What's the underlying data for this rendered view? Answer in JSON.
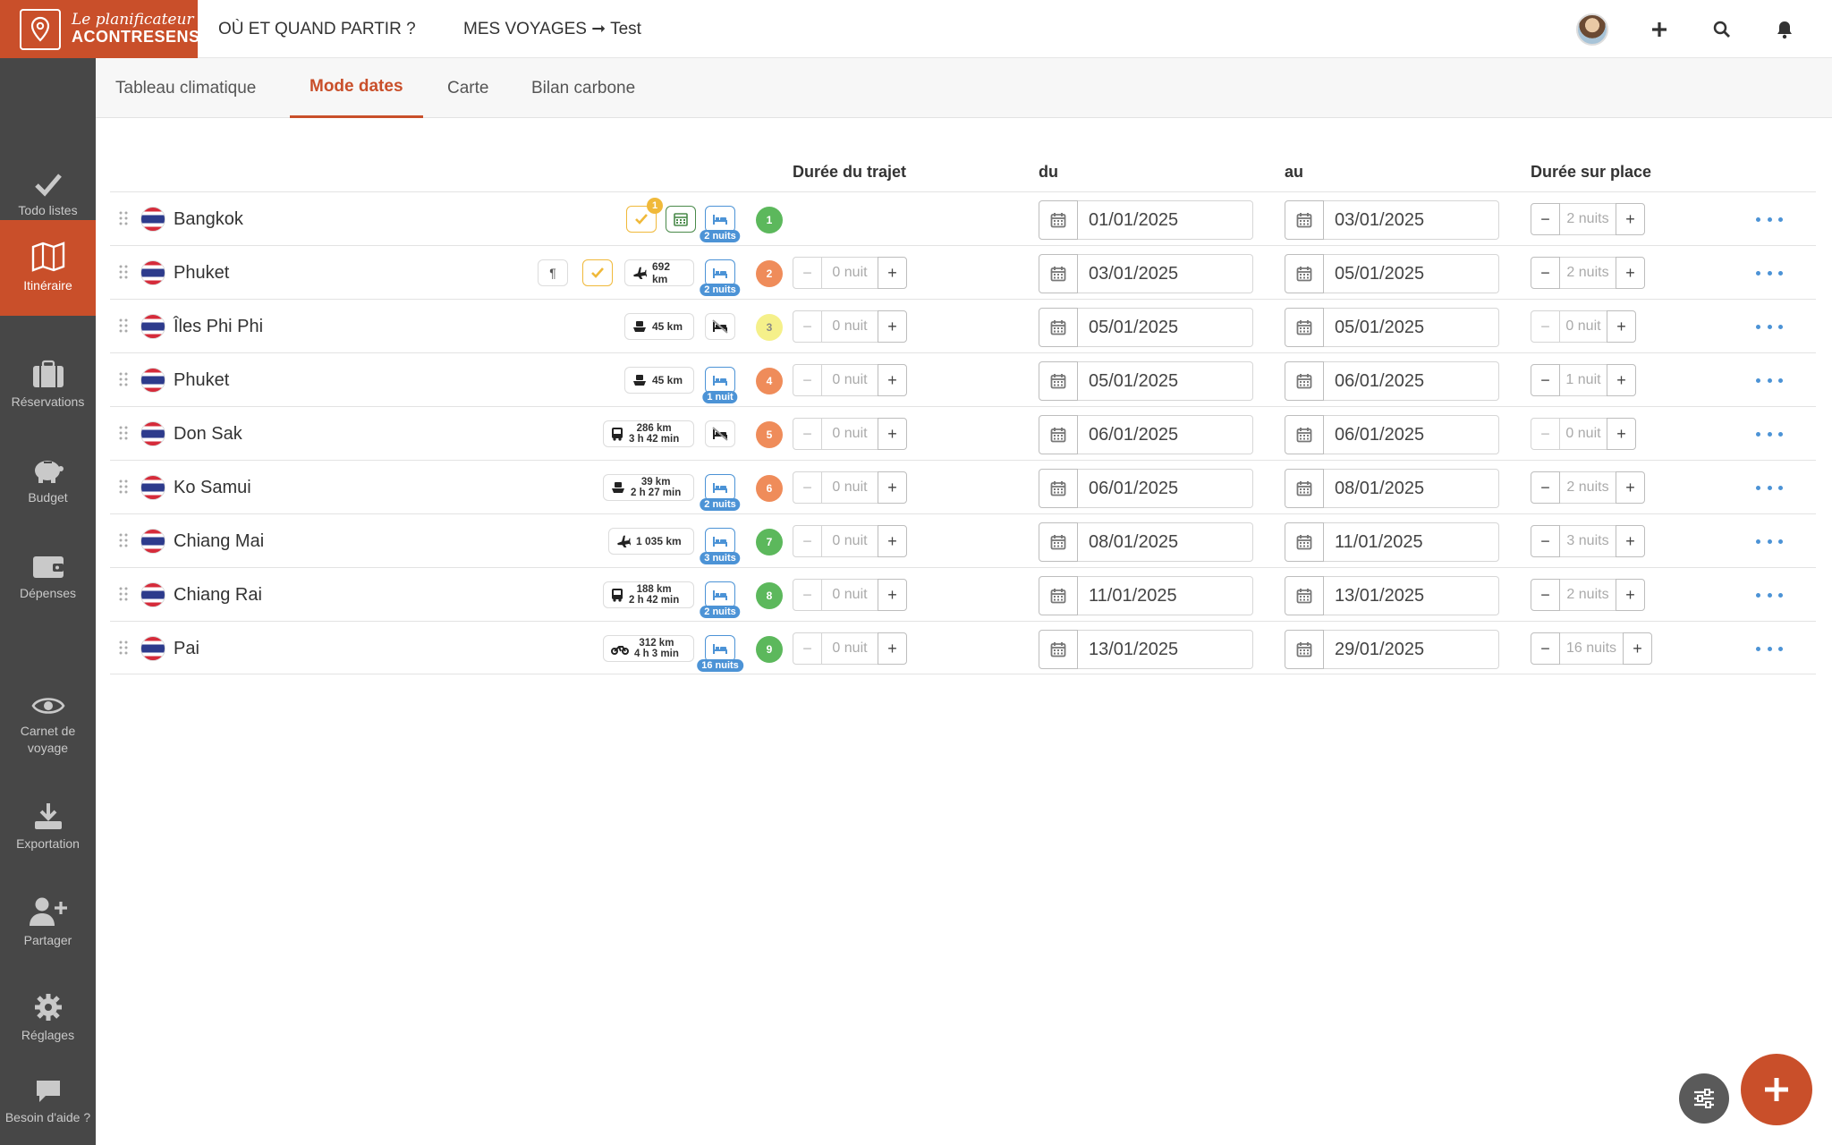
{
  "app": {
    "logo_line1": "Le planificateur",
    "logo_line2": "ACONTRESENS"
  },
  "topnav": {
    "where_when": "OÙ ET QUAND PARTIR ?",
    "my_trips": "MES VOYAGES ➞ Test"
  },
  "sidebar": {
    "items": [
      {
        "label": "Todo listes",
        "icon": "check-icon"
      },
      {
        "label": "Itinéraire",
        "icon": "map-icon",
        "active": true
      },
      {
        "label": "Réservations",
        "icon": "suitcase-icon"
      },
      {
        "label": "Budget",
        "icon": "piggy-bank-icon"
      },
      {
        "label": "Dépenses",
        "icon": "wallet-icon"
      },
      {
        "label": "Carnet de voyage",
        "icon": "eye-icon"
      },
      {
        "label": "Exportation",
        "icon": "download-icon"
      },
      {
        "label": "Partager",
        "icon": "user-plus-icon"
      },
      {
        "label": "Réglages",
        "icon": "gear-icon"
      },
      {
        "label": "Besoin d'aide ?",
        "icon": "chat-icon"
      }
    ]
  },
  "tabs": [
    {
      "label": "Tableau climatique"
    },
    {
      "label": "Mode dates",
      "active": true
    },
    {
      "label": "Carte"
    },
    {
      "label": "Bilan carbone"
    }
  ],
  "columns": {
    "travel": "Durée du trajet",
    "from": "du",
    "to": "au",
    "stay": "Durée sur place"
  },
  "colors": {
    "accent": "#c94f2a",
    "blue": "#4c93d6",
    "sidebar": "#474747"
  },
  "rows": [
    {
      "city": "Bangkok",
      "transport": null,
      "step": "1",
      "step_color": "#5cb85c",
      "travel": null,
      "from": "01/01/2025",
      "to": "03/01/2025",
      "stay": "2 nuits",
      "nights_tag": "2 nuits",
      "bed": true,
      "todo_count": "1"
    },
    {
      "city": "Phuket",
      "transport": {
        "mode": "plane",
        "line1": "692 km",
        "line2": ""
      },
      "step": "2",
      "step_color": "#ef8c5a",
      "travel": "0 nuit",
      "from": "03/01/2025",
      "to": "05/01/2025",
      "stay": "2 nuits",
      "nights_tag": "2 nuits",
      "bed": true
    },
    {
      "city": "Îles Phi Phi",
      "transport": {
        "mode": "boat",
        "line1": "45 km",
        "line2": ""
      },
      "step": "3",
      "step_color": "#f5f08a",
      "travel": "0 nuit",
      "from": "05/01/2025",
      "to": "05/01/2025",
      "stay": "0 nuit",
      "nights_tag": "",
      "bed": false
    },
    {
      "city": "Phuket",
      "transport": {
        "mode": "boat",
        "line1": "45 km",
        "line2": ""
      },
      "step": "4",
      "step_color": "#ef8c5a",
      "travel": "0 nuit",
      "from": "05/01/2025",
      "to": "06/01/2025",
      "stay": "1 nuit",
      "nights_tag": "1 nuit",
      "bed": true
    },
    {
      "city": "Don Sak",
      "transport": {
        "mode": "bus",
        "line1": "286 km",
        "line2": "3 h 42 min"
      },
      "step": "5",
      "step_color": "#ef8c5a",
      "travel": "0 nuit",
      "from": "06/01/2025",
      "to": "06/01/2025",
      "stay": "0 nuit",
      "nights_tag": "",
      "bed": false
    },
    {
      "city": "Ko Samui",
      "transport": {
        "mode": "boat",
        "line1": "39 km",
        "line2": "2 h 27 min"
      },
      "step": "6",
      "step_color": "#ef8c5a",
      "travel": "0 nuit",
      "from": "06/01/2025",
      "to": "08/01/2025",
      "stay": "2 nuits",
      "nights_tag": "2 nuits",
      "bed": true
    },
    {
      "city": "Chiang Mai",
      "transport": {
        "mode": "plane",
        "line1": "1 035 km",
        "line2": ""
      },
      "step": "7",
      "step_color": "#5cb85c",
      "travel": "0 nuit",
      "from": "08/01/2025",
      "to": "11/01/2025",
      "stay": "3 nuits",
      "nights_tag": "3 nuits",
      "bed": true
    },
    {
      "city": "Chiang Rai",
      "transport": {
        "mode": "bus",
        "line1": "188 km",
        "line2": "2 h 42 min"
      },
      "step": "8",
      "step_color": "#5cb85c",
      "travel": "0 nuit",
      "from": "11/01/2025",
      "to": "13/01/2025",
      "stay": "2 nuits",
      "nights_tag": "2 nuits",
      "bed": true
    },
    {
      "city": "Pai",
      "transport": {
        "mode": "motorbike",
        "line1": "312 km",
        "line2": "4 h 3 min"
      },
      "step": "9",
      "step_color": "#5cb85c",
      "travel": "0 nuit",
      "from": "13/01/2025",
      "to": "29/01/2025",
      "stay": "16 nuits",
      "nights_tag": "16 nuits",
      "bed": true
    }
  ]
}
